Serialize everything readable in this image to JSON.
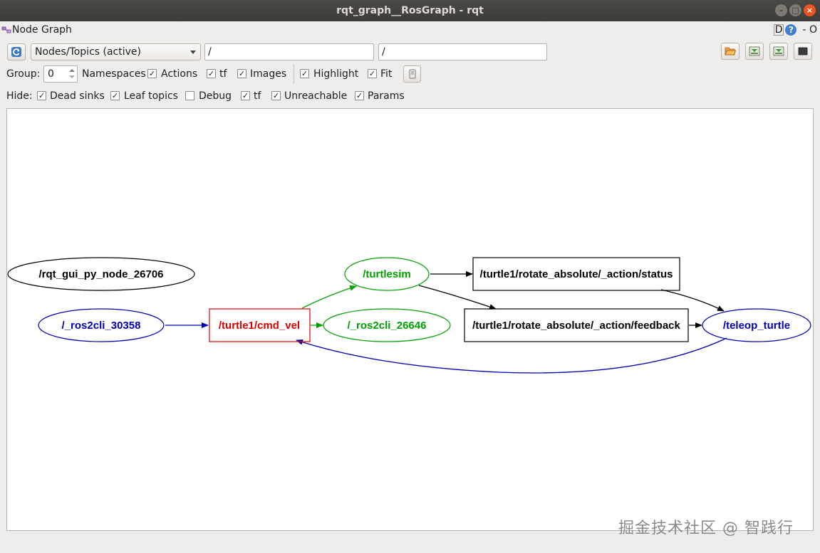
{
  "window": {
    "title": "rqt_graph__RosGraph - rqt"
  },
  "plugin": {
    "title": "Node Graph",
    "ctrl_d": "D",
    "ctrl_help": "?",
    "ctrl_extra": "- O"
  },
  "toolbar": {
    "mode_value": "Nodes/Topics (active)",
    "node_filter_value": "/",
    "topic_filter_value": "/"
  },
  "options": {
    "group_label": "Group:",
    "group_value": "0",
    "namespaces_label": "Namespaces",
    "actions_label": "Actions",
    "tf_label": "tf",
    "images_label": "Images",
    "highlight_label": "Highlight",
    "fit_label": "Fit",
    "namespaces_checked": true,
    "actions_checked": true,
    "tf_checked": true,
    "images_checked": true,
    "highlight_checked": true,
    "fit_checked": true
  },
  "hide": {
    "label": "Hide:",
    "dead_sinks_label": "Dead sinks",
    "leaf_topics_label": "Leaf topics",
    "debug_label": "Debug",
    "tf_label": "tf",
    "unreachable_label": "Unreachable",
    "params_label": "Params",
    "dead_sinks_checked": true,
    "leaf_topics_checked": true,
    "debug_checked": false,
    "tf_checked": true,
    "unreachable_checked": true,
    "params_checked": true
  },
  "graph": {
    "nodes": {
      "rqt_gui": "/rqt_gui_py_node_26706",
      "ros2cli_30358": "/_ros2cli_30358",
      "cmd_vel": "/turtle1/cmd_vel",
      "turtlesim": "/turtlesim",
      "ros2cli_26646": "/_ros2cli_26646",
      "status": "/turtle1/rotate_absolute/_action/status",
      "feedback": "/turtle1/rotate_absolute/_action/feedback",
      "teleop": "/teleop_turtle"
    },
    "colors": {
      "black": "#000000",
      "blue": "#0000b4",
      "red": "#e00000",
      "green": "#00a000"
    }
  },
  "watermark": "掘金技术社区 @ 智践行"
}
